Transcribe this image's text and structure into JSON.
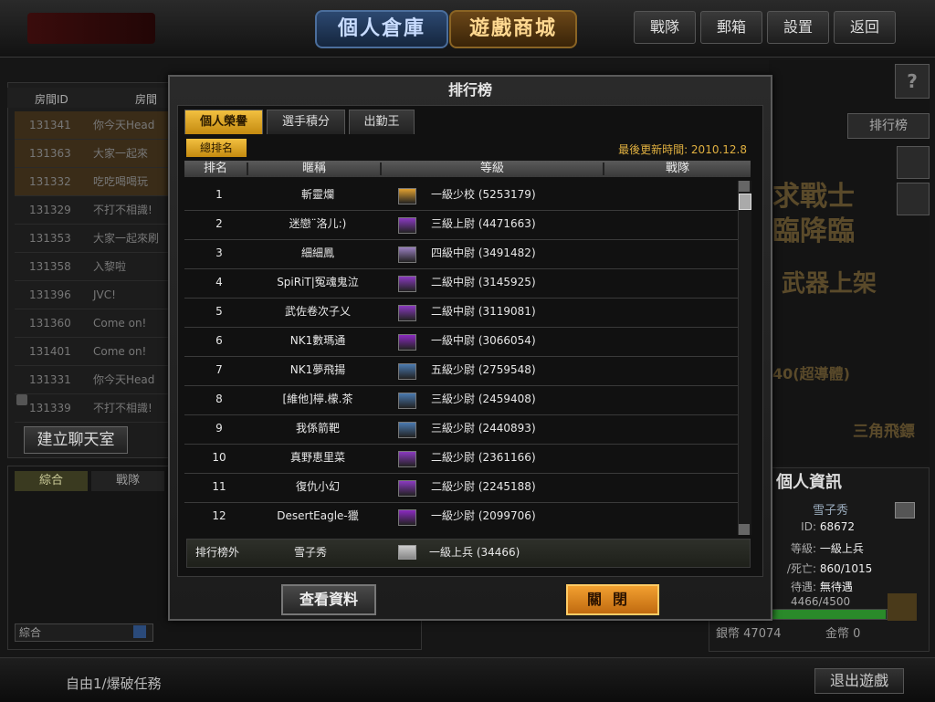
{
  "top": {
    "warehouse": "個人倉庫",
    "mall": "遊戲商城",
    "buttons": [
      "戰隊",
      "郵箱",
      "設置",
      "返回"
    ]
  },
  "left": {
    "header": {
      "room_id": "房間ID",
      "room": "房間"
    },
    "rooms": [
      {
        "id": "131341",
        "name": "你今天Head"
      },
      {
        "id": "131363",
        "name": "大家一起來"
      },
      {
        "id": "131332",
        "name": "吃吃喝喝玩"
      },
      {
        "id": "131329",
        "name": "不打不相識!"
      },
      {
        "id": "131353",
        "name": "大家一起來刷"
      },
      {
        "id": "131358",
        "name": "入黎啦"
      },
      {
        "id": "131396",
        "name": "JVC!"
      },
      {
        "id": "131360",
        "name": "Come on!"
      },
      {
        "id": "131401",
        "name": "Come on!"
      },
      {
        "id": "131331",
        "name": "你今天Head"
      },
      {
        "id": "131339",
        "name": "不打不相識!"
      }
    ],
    "create_chat": "建立聊天室",
    "chat_tabs": [
      "綜合",
      "戰隊"
    ],
    "chat_channel": "綜合"
  },
  "bottom": {
    "mode": "自由1/爆破任務",
    "exit": "退出遊戲"
  },
  "right": {
    "help": "?",
    "rank_button": "排行榜",
    "promo_lines": [
      "求戰士",
      "臨降臨",
      "武器上架",
      "三角飛鏢",
      "40(超導體)"
    ],
    "info_title": "個人資訊",
    "name": "雪子秀",
    "id_label": "ID:",
    "id_value": "68672",
    "level_label": "等級:",
    "level_value": "一級上兵",
    "kd_label": "/死亡:",
    "kd_value": "860/1015",
    "treat_label": "待遇:",
    "treat_value": "無待遇",
    "exp_text": "4466/4500",
    "exp_fraction": 0.99,
    "silver_label": "銀幣",
    "silver_value": "47074",
    "gold_label": "金幣",
    "gold_value": "0"
  },
  "modal": {
    "title": "排行榜",
    "tabs": [
      "個人榮譽",
      "選手積分",
      "出勤王"
    ],
    "subtab": "總排名",
    "updated": "最後更新時間: 2010.12.8",
    "columns": [
      "排名",
      "暱稱",
      "等級",
      "戰隊"
    ],
    "rows": [
      {
        "rank": "1",
        "name": "斬靈爛",
        "level": "一級少校 (5253179)",
        "icon_color": "#e0a030"
      },
      {
        "rank": "2",
        "name": "迷戀¨洛儿:)",
        "level": "三級上尉 (4471663)",
        "icon_color": "#8a3ac0"
      },
      {
        "rank": "3",
        "name": "細細鳳",
        "level": "四級中尉 (3491482)",
        "icon_color": "#9a80c0"
      },
      {
        "rank": "4",
        "name": "SpiRiT|冤魂鬼泣",
        "level": "二級中尉 (3145925)",
        "icon_color": "#8a3ac0"
      },
      {
        "rank": "5",
        "name": "武佐卷次子乂",
        "level": "二級中尉 (3119081)",
        "icon_color": "#8a3ac0"
      },
      {
        "rank": "6",
        "name": "NK1數瑪通",
        "level": "一級中尉 (3066054)",
        "icon_color": "#8a2ac0"
      },
      {
        "rank": "7",
        "name": "NK1夢飛揚",
        "level": "五級少尉 (2759548)",
        "icon_color": "#4a7ab0"
      },
      {
        "rank": "8",
        "name": "[維他]檸.檬.茶",
        "level": "三級少尉 (2459408)",
        "icon_color": "#4a7ab0"
      },
      {
        "rank": "9",
        "name": "我係箭靶",
        "level": "三級少尉 (2440893)",
        "icon_color": "#4a7ab0"
      },
      {
        "rank": "10",
        "name": "真野恵里菜",
        "level": "二級少尉 (2361166)",
        "icon_color": "#8a3ac0"
      },
      {
        "rank": "11",
        "name": "復仇小幻",
        "level": "二級少尉 (2245188)",
        "icon_color": "#8a3ac0"
      },
      {
        "rank": "12",
        "name": "DesertEagle-獵",
        "level": "一級少尉 (2099706)",
        "icon_color": "#8a2ac0"
      }
    ],
    "my": {
      "label": "排行榜外",
      "name": "雪子秀",
      "level": "一級上兵 (34466)"
    },
    "view_button": "查看資料",
    "close_button": "關閉"
  }
}
